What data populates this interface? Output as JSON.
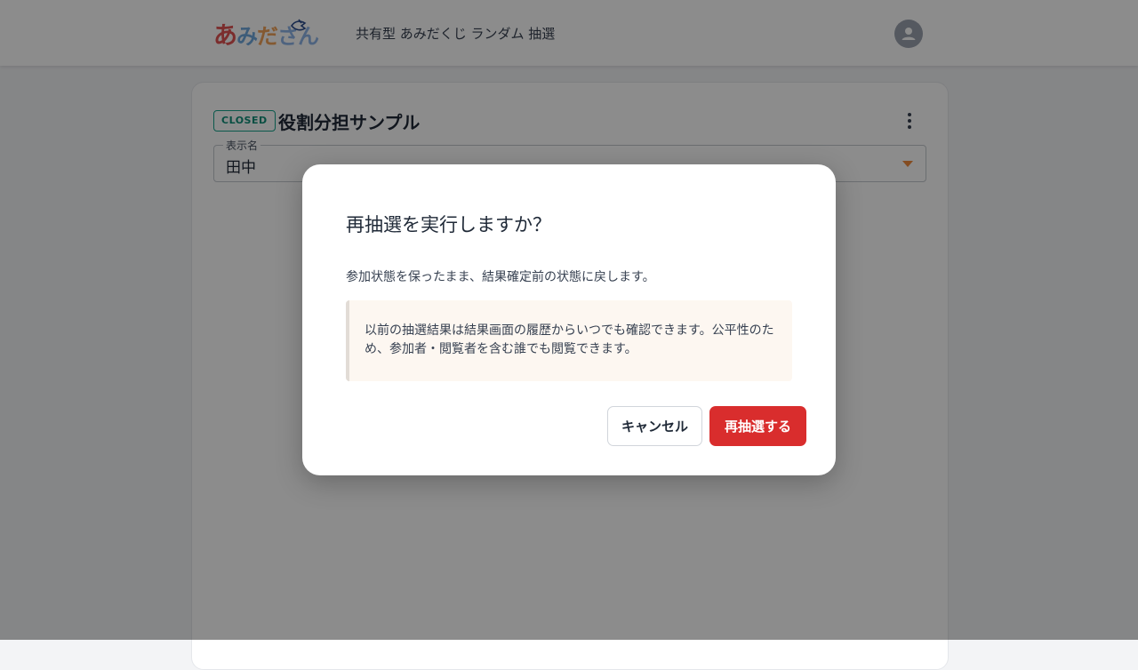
{
  "header": {
    "logo": {
      "ch1": "あ",
      "ch2": "み",
      "ch3": "だ",
      "ch4": "さん"
    },
    "subtitle": "共有型 あみだくじ ランダム 抽選",
    "avatar_icon": "user-icon"
  },
  "card": {
    "status_badge": "CLOSED",
    "title": "役割分担サンプル",
    "menu_icon": "more-vertical-icon",
    "display_name_field": {
      "label": "表示名",
      "value": "田中"
    }
  },
  "dialog": {
    "title": "再抽選を実行しますか？",
    "message": "参加状態を保ったまま、結果確定前の状態に戻します。",
    "notice": "以前の抽選結果は結果画面の履歴からいつでも確認できます。公平性のため、参加者・閲覧者を含む誰でも閲覧できます。",
    "cancel_label": "キャンセル",
    "confirm_label": "再抽選する"
  },
  "colors": {
    "badge": "#14a38b",
    "confirm_button": "#d92d2d",
    "caret": "#f08a3c",
    "notice_bg": "#fdf7f1"
  }
}
